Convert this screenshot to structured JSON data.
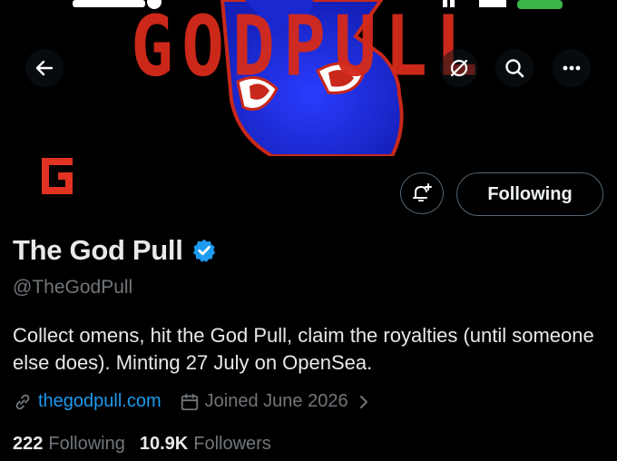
{
  "banner": {
    "text": "GODPULL"
  },
  "profile": {
    "name": "The God Pull",
    "handle": "@TheGodPull",
    "bio": "Collect omens, hit the God Pull, claim the royalties (until someone else does). Minting 27 July on OpenSea.",
    "website": "thegodpull.com",
    "joined": "Joined June 2026"
  },
  "actions": {
    "follow_label": "Following"
  },
  "stats": {
    "following_count": "222",
    "following_label": "Following",
    "followers_count": "10.9K",
    "followers_label": "Followers"
  },
  "icons": {
    "back": "back-arrow-icon",
    "hide": "eye-slash-icon",
    "search": "search-icon",
    "more": "more-dots-icon",
    "notify": "bell-plus-icon",
    "verified": "verified-badge-icon",
    "link": "link-icon",
    "calendar": "calendar-icon",
    "chevron": "chevron-right-icon"
  },
  "colors": {
    "accent": "#1d9bf0",
    "brand": "#d42a1c",
    "muted": "#71767b"
  }
}
